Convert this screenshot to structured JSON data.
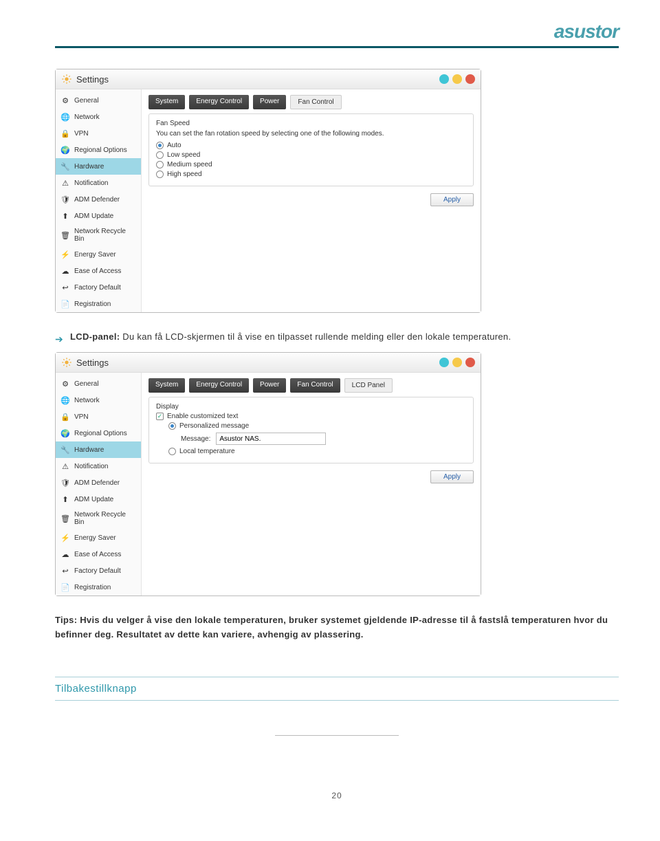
{
  "brand": "asustor",
  "screenshot1": {
    "title": "Settings",
    "sidebar": [
      "General",
      "Network",
      "VPN",
      "Regional Options",
      "Hardware",
      "Notification",
      "ADM Defender",
      "ADM Update",
      "Network Recycle Bin",
      "Energy Saver",
      "Ease of Access",
      "Factory Default",
      "Registration"
    ],
    "activeIndex": 4,
    "tabs": [
      "System",
      "Energy Control",
      "Power",
      "Fan Control"
    ],
    "activeTab": 3,
    "panelTitle": "Fan Speed",
    "panelDesc": "You can set the fan rotation speed by selecting one of the following modes.",
    "options": [
      "Auto",
      "Low speed",
      "Medium speed",
      "High speed"
    ],
    "selected": 0,
    "apply": "Apply"
  },
  "bullet": {
    "label": "LCD-panel:",
    "text": " Du kan få LCD-skjermen til å vise en tilpasset rullende melding eller den lokale temperaturen."
  },
  "screenshot2": {
    "title": "Settings",
    "sidebar": [
      "General",
      "Network",
      "VPN",
      "Regional Options",
      "Hardware",
      "Notification",
      "ADM Defender",
      "ADM Update",
      "Network Recycle Bin",
      "Energy Saver",
      "Ease of Access",
      "Factory Default",
      "Registration"
    ],
    "activeIndex": 4,
    "tabs": [
      "System",
      "Energy Control",
      "Power",
      "Fan Control",
      "LCD Panel"
    ],
    "activeTab": 4,
    "panelTitle": "Display",
    "chk": "Enable customized text",
    "opt1": "Personalized message",
    "msgLabel": "Message:",
    "msgValue": "Asustor NAS.",
    "opt2": "Local temperature",
    "apply": "Apply"
  },
  "tips": "Tips: Hvis du velger å vise den lokale temperaturen, bruker systemet gjeldende IP-adresse til å fastslå temperaturen hvor du befinner deg. Resultatet av dette kan variere, avhengig av plassering.",
  "sectionHeader": "Tilbakestillknapp",
  "pageNum": "20"
}
